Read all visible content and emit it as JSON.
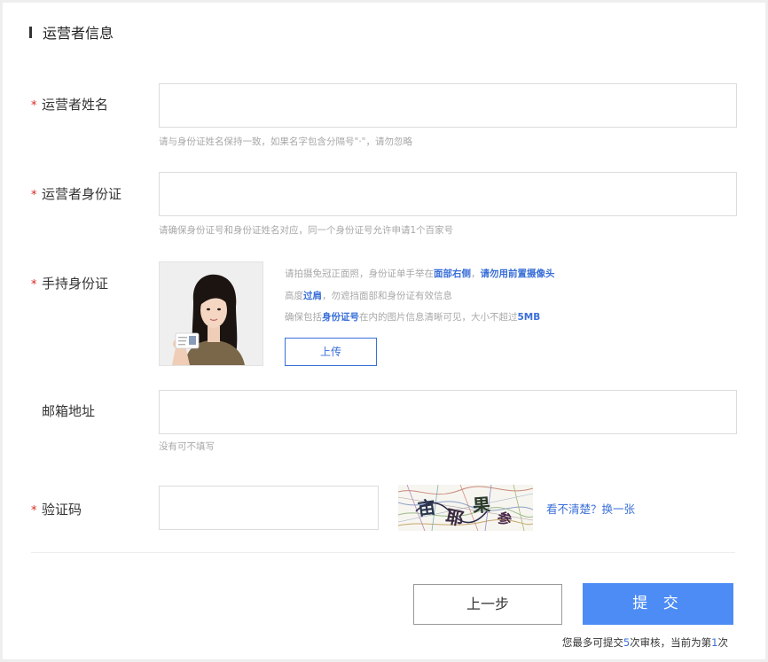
{
  "section": {
    "title": "运营者信息"
  },
  "required_mark": "*",
  "fields": {
    "name": {
      "label": "运营者姓名",
      "value": "",
      "hint": "请与身份证姓名保持一致，如果名字包含分隔号\"·\"，请勿忽略"
    },
    "id_number": {
      "label": "运营者身份证",
      "value": "",
      "hint": "请确保身份证号和身份证姓名对应，同一个身份证号允许申请1个百家号"
    },
    "id_photo": {
      "label": "手持身份证",
      "info_line1": {
        "text1": "请拍摄免冠正面照，身份证单手举在",
        "hl1": "面部右侧",
        "text2": "，",
        "hl2": "请勿用前置摄像头"
      },
      "info_line2": {
        "text1": "高度",
        "hl1": "过肩",
        "text2": "，勿遮挡面部和身份证有效信息"
      },
      "info_line3": {
        "text1": "确保包括",
        "hl1": "身份证号",
        "text2": "在内的图片信息清晰可见，大小不超过",
        "hl2": "5MB"
      },
      "upload_label": "上传"
    },
    "email": {
      "label": "邮箱地址",
      "value": "",
      "hint": "没有可不填写"
    },
    "captcha": {
      "label": "验证码",
      "value": "",
      "image_chars": [
        "亩",
        "耶",
        "果",
        "参"
      ],
      "refresh_label": "看不清楚？换一张"
    }
  },
  "actions": {
    "prev_label": "上一步",
    "submit_label": "提 交"
  },
  "review_note": {
    "prefix": "您最多可提交",
    "max_count": "5",
    "middle": "次审核，当前为第",
    "current_count": "1",
    "suffix": "次"
  },
  "colors": {
    "accent": "#3a6fd8",
    "submit_bg": "#4d8cf5",
    "required": "#d9261c",
    "hint": "#a8a8a8"
  }
}
